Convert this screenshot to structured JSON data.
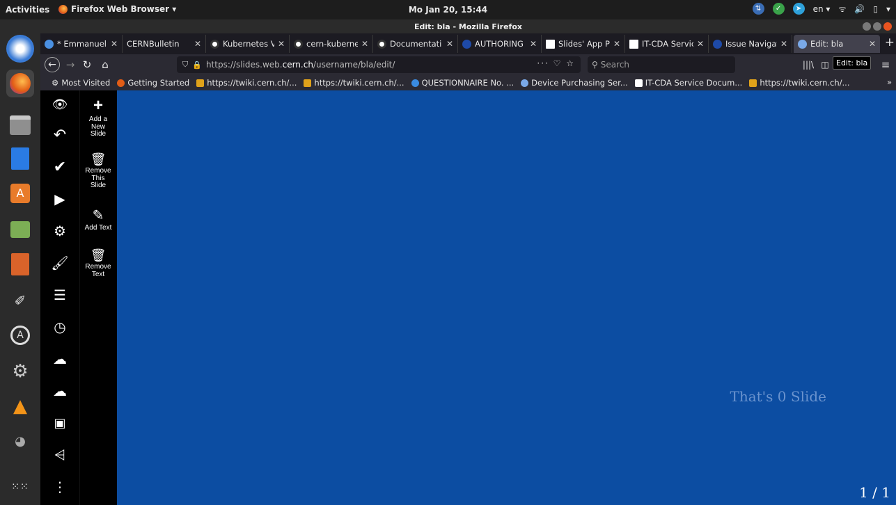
{
  "topbar": {
    "activities": "Activities",
    "app_name": "Firefox Web Browser ▾",
    "clock": "Mo Jan 20, 15:44",
    "lang": "en ▾"
  },
  "window": {
    "title": "Edit: bla - Mozilla Firefox"
  },
  "tabs": [
    {
      "label": "* Emmanuel ",
      "color": "#4a90e2"
    },
    {
      "label": "CERNBulletin",
      "color": "#1c1b22"
    },
    {
      "label": "Kubernetes V",
      "color": "#ffffff"
    },
    {
      "label": "cern-kuberne",
      "color": "#ffffff"
    },
    {
      "label": "Documentati",
      "color": "#ffffff"
    },
    {
      "label": "AUTHORING ",
      "color": "#1e4aa8"
    },
    {
      "label": "Slides' App P",
      "color": "#ffffff"
    },
    {
      "label": "IT-CDA Servic",
      "color": "#ffffff"
    },
    {
      "label": "Issue Navigat",
      "color": "#1e4aa8"
    },
    {
      "label": "Edit: bla",
      "color": "#7aa9e8"
    }
  ],
  "navbar": {
    "url_prefix": "https://slides.web.",
    "url_domain": "cern.ch",
    "url_suffix": "/username/bla/edit/",
    "url_tools": "··· ♡ ☆",
    "search_placeholder": "Search",
    "tooltip": "Edit: bla"
  },
  "bookmarks": [
    {
      "label": "Most Visited",
      "color": "#cccccc"
    },
    {
      "label": "Getting Started",
      "color": "#e25d16"
    },
    {
      "label": "https://twiki.cern.ch/...",
      "color": "#e0a21a"
    },
    {
      "label": "https://twiki.cern.ch/...",
      "color": "#e0a21a"
    },
    {
      "label": "QUESTIONNAIRE No. ...",
      "color": "#3a8be0"
    },
    {
      "label": "Device Purchasing Ser...",
      "color": "#7aa9e8"
    },
    {
      "label": "IT-CDA Service Docum...",
      "color": "#ffffff"
    },
    {
      "label": "https://twiki.cern.ch/...",
      "color": "#e0a21a"
    }
  ],
  "toolbar_actions": [
    {
      "icon": "+",
      "label": "Add a New Slide"
    },
    {
      "icon": "🗑",
      "label": "Remove This Slide"
    },
    {
      "icon": "✎",
      "label": "Add Text"
    },
    {
      "icon": "🗑",
      "label": "Remove Text"
    }
  ],
  "stage": {
    "text": "That's 0 Slide",
    "counter": "1 / 1",
    "background": "#0c4da2"
  }
}
